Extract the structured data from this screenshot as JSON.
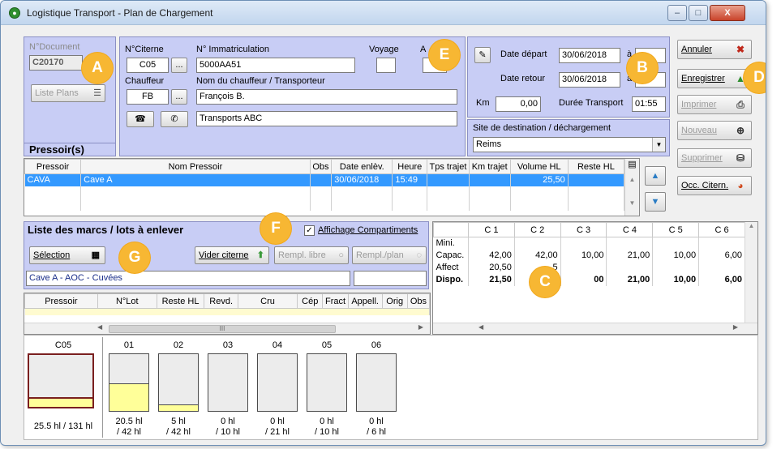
{
  "window": {
    "title": "Logistique Transport - Plan de Chargement",
    "min": "–",
    "max": "□",
    "close": "X"
  },
  "document": {
    "label": "N°Document",
    "value": "C20170",
    "liste_plans": "Liste Plans"
  },
  "citerne": {
    "label": "N°Citerne",
    "value": "C05",
    "browse": "...",
    "immat_label": "N° Immatriculation",
    "immat_value": "5000AA51",
    "voyage_label": "Voyage",
    "a_label": "A"
  },
  "chauffeur": {
    "label": "Chauffeur",
    "value": "FB",
    "browse": "...",
    "nom_label": "Nom du chauffeur / Transporteur",
    "nom_value": "François B.",
    "transporteur": "Transports ABC"
  },
  "trajet": {
    "depart_label": "Date départ",
    "depart_value": "30/06/2018",
    "a1": "à",
    "retour_label": "Date retour",
    "retour_value": "30/06/2018",
    "a2": "à",
    "km_label": "Km",
    "km_value": "0,00",
    "duree_label": "Durée Transport",
    "duree_value": "01:55",
    "site_label": "Site de destination / déchargement",
    "site_value": "Reims"
  },
  "actions": {
    "annuler": "Annuler",
    "enregistrer": "Enregistrer",
    "imprimer": "Imprimer",
    "nouveau": "Nouveau",
    "supprimer": "Supprimer",
    "occ": "Occ. Citern."
  },
  "pressoirs": {
    "title": "Pressoir(s)",
    "columns": [
      "Pressoir",
      "Nom Pressoir",
      "Obs",
      "Date enlèv.",
      "Heure",
      "Tps trajet",
      "Km trajet",
      "Volume HL",
      "Reste HL"
    ],
    "rows": [
      [
        "CAVA",
        "Cave A",
        "",
        "30/06/2018",
        "15:49",
        "",
        "",
        "25,50",
        ""
      ]
    ]
  },
  "marcs": {
    "title": "Liste des marcs / lots à enlever",
    "affichage": "Affichage Compartiments",
    "selection": "Sélection",
    "vider": "Vider citerne",
    "rempl_libre": "Rempl. libre",
    "rempl_plan": "Rempl./plan",
    "cuvee": "Cave A - AOC - Cuvées",
    "columns": [
      "Pressoir",
      "N°Lot",
      "Reste HL",
      "Revd.",
      "Cru",
      "Cép",
      "Fract",
      "Appell.",
      "Orig",
      "Obs"
    ],
    "scroll_glyph": "III"
  },
  "compartiments": {
    "columns": [
      "C 1",
      "C 2",
      "C 3",
      "C 4",
      "C 5",
      "C 6"
    ],
    "rows": [
      {
        "label": "Mini.",
        "values": [
          "",
          "",
          "",
          "",
          "",
          ""
        ],
        "bold": false
      },
      {
        "label": "Capac.",
        "values": [
          "42,00",
          "42,00",
          "10,00",
          "21,00",
          "10,00",
          "6,00"
        ],
        "bold": false
      },
      {
        "label": "Affect",
        "values": [
          "20,50",
          "5",
          "",
          "",
          "",
          ""
        ],
        "bold": false
      },
      {
        "label": "Dispo.",
        "values": [
          "21,50",
          "37,",
          "00",
          "21,00",
          "10,00",
          "6,00"
        ],
        "bold": true
      }
    ]
  },
  "tanks": {
    "main": {
      "name": "C05",
      "caption": "25.5 hl / 131 hl",
      "fill": 0.19
    },
    "items": [
      {
        "name": "01",
        "line1": "20.5 hl",
        "line2": "/ 42 hl",
        "fill": 0.49
      },
      {
        "name": "02",
        "line1": "5 hl",
        "line2": "/ 42 hl",
        "fill": 0.12
      },
      {
        "name": "03",
        "line1": "0 hl",
        "line2": "/ 10 hl",
        "fill": 0
      },
      {
        "name": "04",
        "line1": "0 hl",
        "line2": "/ 21 hl",
        "fill": 0
      },
      {
        "name": "05",
        "line1": "0 hl",
        "line2": "/ 10 hl",
        "fill": 0
      },
      {
        "name": "06",
        "line1": "0 hl",
        "line2": "/ 6 hl",
        "fill": 0
      }
    ]
  },
  "badges": [
    "A",
    "B",
    "C",
    "D",
    "E",
    "F",
    "G"
  ],
  "colors": {
    "panel": "#c8cdf5",
    "badge": "#f7b733",
    "selection": "#3399ff",
    "fill": "#ffff99"
  }
}
